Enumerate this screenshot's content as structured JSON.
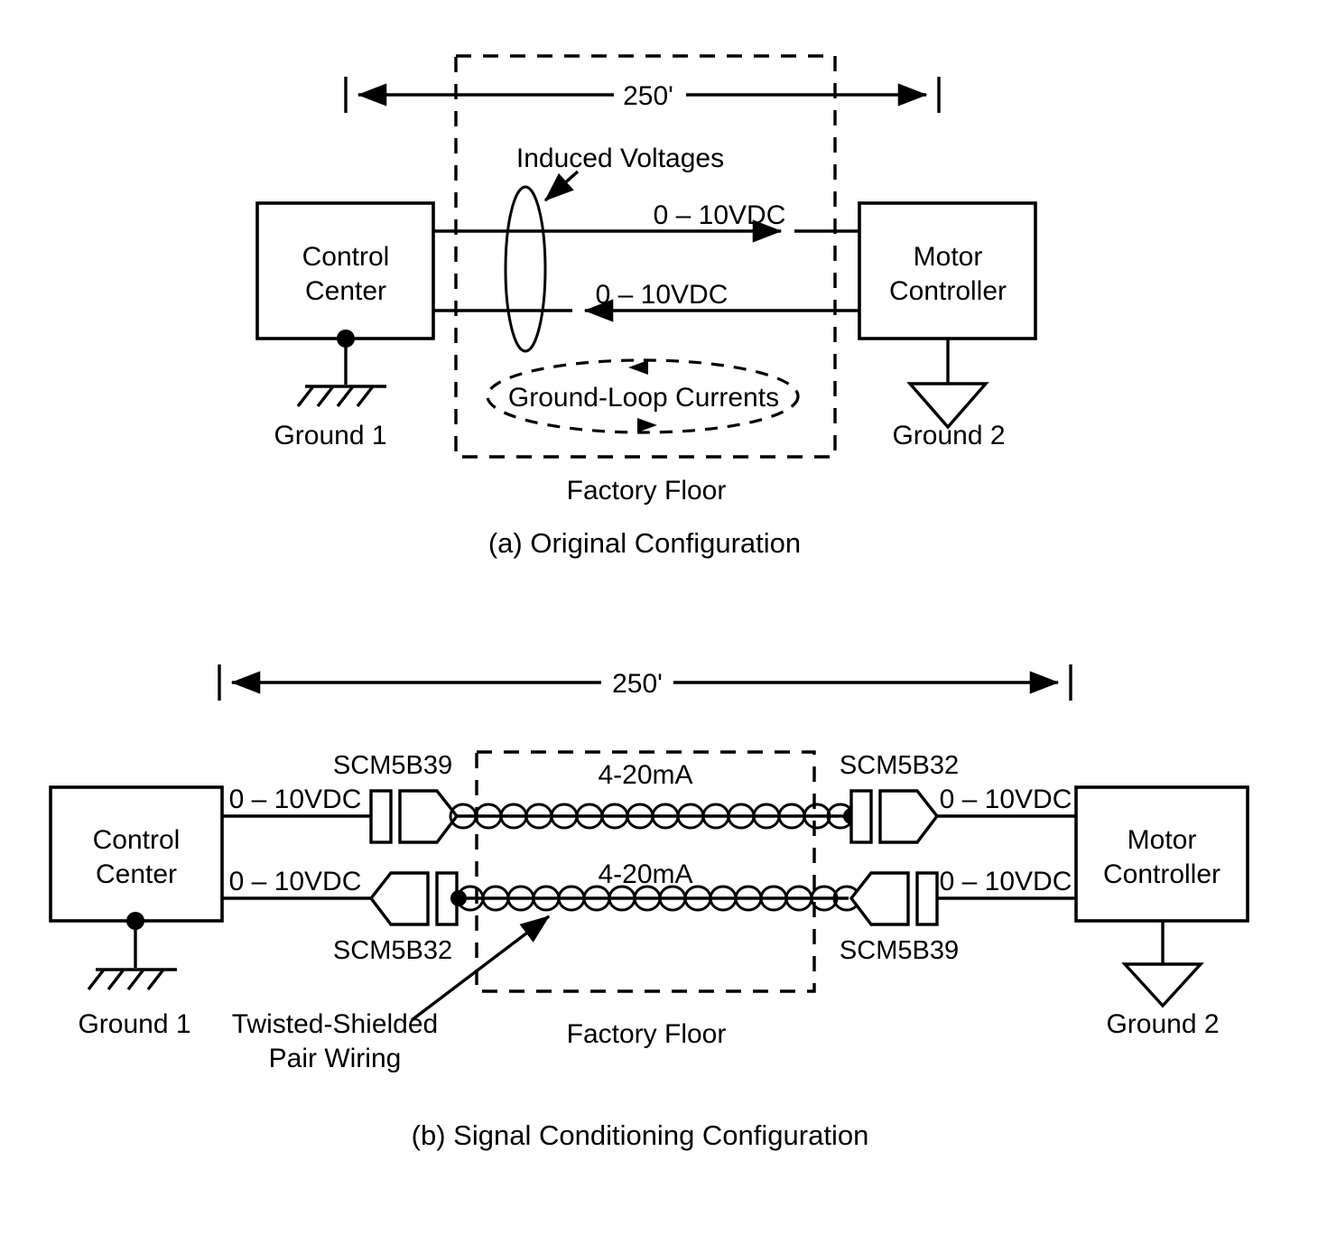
{
  "figure": {
    "title_a": "(a) Original Configuration",
    "title_b": "(b) Signal Conditioning Configuration"
  },
  "panel_a": {
    "dimension_label": "250'",
    "control_center_line1": "Control",
    "control_center_line2": "Center",
    "motor_controller_line1": "Motor",
    "motor_controller_line2": "Controller",
    "induced_voltages_label": "Induced Voltages",
    "signal_top_label": "0 – 10VDC",
    "signal_bottom_label": "0 – 10VDC",
    "ground_loop_label": "Ground-Loop Currents",
    "ground1_label": "Ground 1",
    "ground2_label": "Ground 2",
    "factory_floor_label": "Factory Floor"
  },
  "panel_b": {
    "dimension_label": "250'",
    "control_center_line1": "Control",
    "control_center_line2": "Center",
    "motor_controller_line1": "Motor",
    "motor_controller_line2": "Controller",
    "module_top_left": "SCM5B39",
    "module_top_right": "SCM5B32",
    "module_bottom_left": "SCM5B32",
    "module_bottom_right": "SCM5B39",
    "vdc_top_left": "0 – 10VDC",
    "vdc_top_right": "0 – 10VDC",
    "vdc_bottom_left": "0 – 10VDC",
    "vdc_bottom_right": "0 – 10VDC",
    "current_top_label": "4-20mA",
    "current_bottom_label": "4-20mA",
    "twisted_pair_line1": "Twisted-Shielded",
    "twisted_pair_line2": "Pair Wiring",
    "ground1_label": "Ground 1",
    "ground2_label": "Ground 2",
    "factory_floor_label": "Factory Floor"
  },
  "colors": {
    "ink": "#000000",
    "paper": "#ffffff"
  }
}
